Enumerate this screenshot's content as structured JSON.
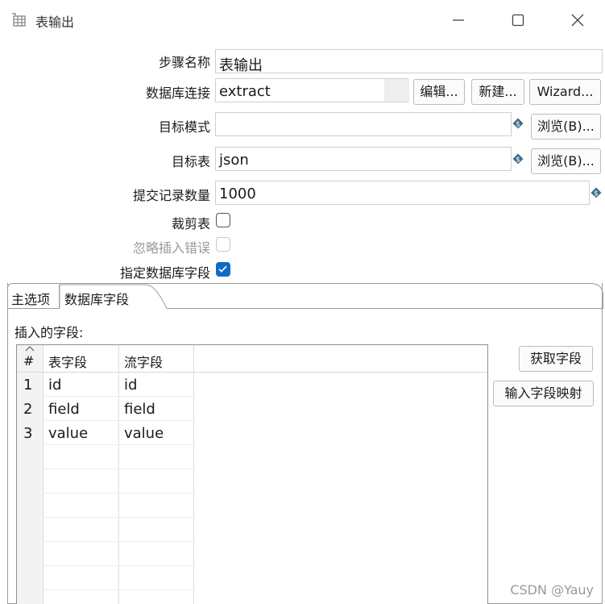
{
  "window": {
    "title": "表输出",
    "app_icon": "table-output-icon",
    "controls": [
      "minimize-icon",
      "maximize-icon",
      "close-icon"
    ]
  },
  "form": {
    "step_name": {
      "label": "步骤名称",
      "value": "表输出"
    },
    "db_connection": {
      "label": "数据库连接",
      "value": "extract",
      "edit": "编辑...",
      "new": "新建...",
      "wizard": "Wizard..."
    },
    "target_schema": {
      "label": "目标模式",
      "value": "",
      "browse": "浏览(B)..."
    },
    "target_table": {
      "label": "目标表",
      "value": "json",
      "browse": "浏览(B)..."
    },
    "commit_size": {
      "label": "提交记录数量",
      "value": "1000"
    },
    "truncate": {
      "label": "裁剪表",
      "checked": false
    },
    "ignore_errors": {
      "label": "忽略插入错误",
      "checked": false,
      "enabled": false
    },
    "specify_fields": {
      "label": "指定数据库字段",
      "checked": true
    }
  },
  "tabs": [
    {
      "label": "主选项",
      "active": false
    },
    {
      "label": "数据库字段",
      "active": true
    }
  ],
  "fields_panel": {
    "label": "插入的字段:",
    "get_fields": "获取字段",
    "map_fields": "输入字段映射",
    "columns": [
      "#",
      "表字段",
      "流字段"
    ],
    "rows": [
      {
        "num": "1",
        "table_field": "id",
        "stream_field": "id"
      },
      {
        "num": "2",
        "table_field": "field",
        "stream_field": "field"
      },
      {
        "num": "3",
        "table_field": "value",
        "stream_field": "value"
      }
    ]
  },
  "colors": {
    "accent": "#0f6cc2",
    "border": "#cfcfcf"
  },
  "watermark": "CSDN @Yauy"
}
